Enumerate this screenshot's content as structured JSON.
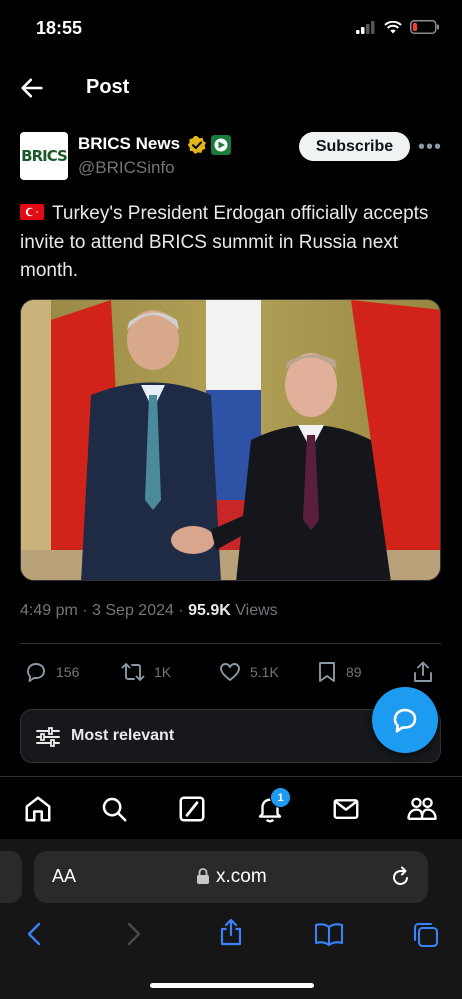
{
  "status_bar": {
    "time": "18:55"
  },
  "header": {
    "title": "Post"
  },
  "author": {
    "avatar_text": "BRICS",
    "name": "BRICS News",
    "handle": "@BRICSinfo",
    "subscribe_label": "Subscribe"
  },
  "tweet": {
    "text": "Turkey's President Erdogan officially accepts invite to attend BRICS summit in Russia next month."
  },
  "meta": {
    "time": "4:49 pm",
    "date": "3 Sep 2024",
    "views_count": "95.9K",
    "views_label": "Views"
  },
  "actions": {
    "replies": "156",
    "reposts": "1K",
    "likes": "5.1K",
    "bookmarks": "89"
  },
  "sort": {
    "label": "Most relevant"
  },
  "tabbar": {
    "notification_count": "1"
  },
  "safari": {
    "aa_label": "AA",
    "url": "x.com"
  },
  "colors": {
    "accent": "#1d9bf0",
    "verified_gold": "#e2b719",
    "background": "#000000",
    "secondary_text": "#71767b"
  }
}
